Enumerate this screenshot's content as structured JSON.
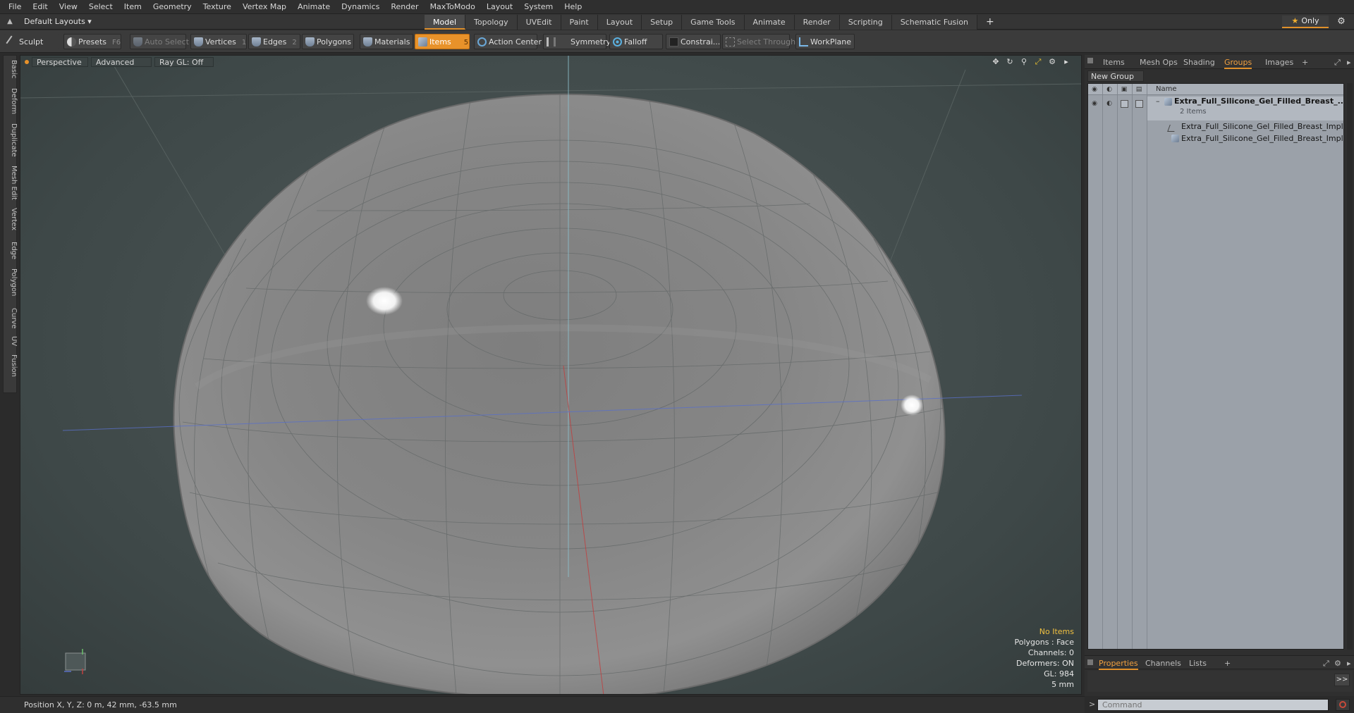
{
  "menu": [
    "File",
    "Edit",
    "View",
    "Select",
    "Item",
    "Geometry",
    "Texture",
    "Vertex Map",
    "Animate",
    "Dynamics",
    "Render",
    "MaxToModo",
    "Layout",
    "System",
    "Help"
  ],
  "layout_dropdown": "Default Layouts ▾",
  "mode_tabs": [
    "Model",
    "Topology",
    "UVEdit",
    "Paint",
    "Layout",
    "Setup",
    "Game Tools",
    "Animate",
    "Render",
    "Scripting",
    "Schematic Fusion",
    "+"
  ],
  "active_mode_tab": "Model",
  "only_label": "Only",
  "toolbar": {
    "sculpt": "Sculpt",
    "presets": "Presets",
    "presets_key": "F6",
    "auto_select": "Auto Select",
    "vertices": "Vertices",
    "vertices_count": "1",
    "edges": "Edges",
    "edges_count": "2",
    "polygons": "Polygons",
    "materials": "Materials",
    "items": "Items",
    "items_count": "5",
    "action_center": "Action Center",
    "symmetry": "Symmetry",
    "falloff": "Falloff",
    "constraints": "Constrai...",
    "select_through": "Select Through",
    "workplane": "WorkPlane"
  },
  "left_tabs": [
    "Basic",
    "Deform",
    "Duplicate",
    "Mesh Edit",
    "Vertex",
    "Edge",
    "Polygon",
    "Curve",
    "UV",
    "Fusion"
  ],
  "viewport": {
    "view_mode": "Perspective",
    "shading": "Advanced",
    "raygl": "Ray GL: Off",
    "stats": {
      "no_items": "No Items",
      "polygons": "Polygons : Face",
      "channels": "Channels: 0",
      "deformers": "Deformers: ON",
      "gl": "GL: 984",
      "scale": "5 mm"
    },
    "colors": {
      "background": "#465050",
      "mesh": "#8a8a8a",
      "wire": "#5c6060",
      "axis_y": "#88b8c8",
      "axis_x": "#c04040",
      "axis_z": "#5a70c8"
    }
  },
  "status": "Position X, Y, Z:  0 m, 42 mm, -63.5 mm",
  "right_panel": {
    "tabs": [
      "Items",
      "Mesh Ops",
      "Shading",
      "Groups",
      "Images",
      "+"
    ],
    "active_tab": "Groups",
    "new_group": "New Group",
    "column_name": "Name",
    "group": {
      "name": "Extra_Full_Silicone_Gel_Filled_Breast_...",
      "count": "2 Items",
      "children": [
        "Extra_Full_Silicone_Gel_Filled_Breast_Implant",
        "Extra_Full_Silicone_Gel_Filled_Breast_Impla..."
      ]
    },
    "bottom_tabs": [
      "Properties",
      "Channels",
      "Lists",
      "+"
    ],
    "active_bottom_tab": "Properties",
    "expand_label": ">>",
    "command_prompt": ">",
    "command_placeholder": "Command"
  },
  "accent_color": "#e8922a"
}
